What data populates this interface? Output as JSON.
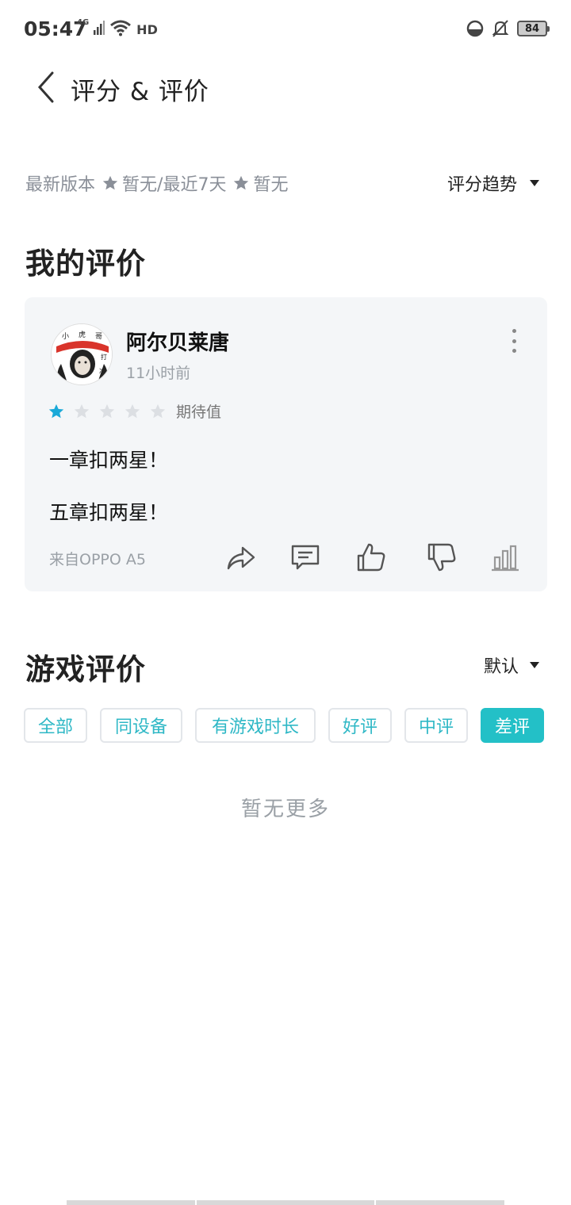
{
  "status_bar": {
    "time": "05:47",
    "network": "4G",
    "wifi_label": "HD",
    "battery": "84"
  },
  "header": {
    "back_icon": "chevron-left-icon",
    "title": "评分 & 评价"
  },
  "rating_summary": {
    "latest_version_label": "最新版本",
    "latest_version_value": "暂无",
    "separator_label": "/最近7天",
    "recent_value": "暂无",
    "trend_button": "评分趋势"
  },
  "my_review": {
    "section_title": "我的评价",
    "username": "阿尔贝莱唐",
    "time_ago": "11小时前",
    "rating": 1,
    "rating_max": 5,
    "rating_label": "期待值",
    "lines": [
      "一章扣两星！",
      "五章扣两星！"
    ],
    "device": "来自OPPO A5",
    "avatar_text": [
      "小",
      "虎",
      "哥",
      "打",
      "冲"
    ],
    "actions": [
      "share-icon",
      "comment-icon",
      "like-icon",
      "dislike-icon",
      "stats-icon"
    ]
  },
  "game_reviews": {
    "section_title": "游戏评价",
    "sort_label": "默认",
    "filters": [
      {
        "label": "全部",
        "active": false
      },
      {
        "label": "同设备",
        "active": false
      },
      {
        "label": "有游戏时长",
        "active": false
      },
      {
        "label": "好评",
        "active": false
      },
      {
        "label": "中评",
        "active": false
      },
      {
        "label": "差评",
        "active": true
      }
    ],
    "empty_text": "暂无更多"
  },
  "colors": {
    "accent": "#23c0c7",
    "star_filled": "#1aa9d8",
    "star_empty": "#dcdfe3",
    "card_bg": "#f4f6f8"
  }
}
